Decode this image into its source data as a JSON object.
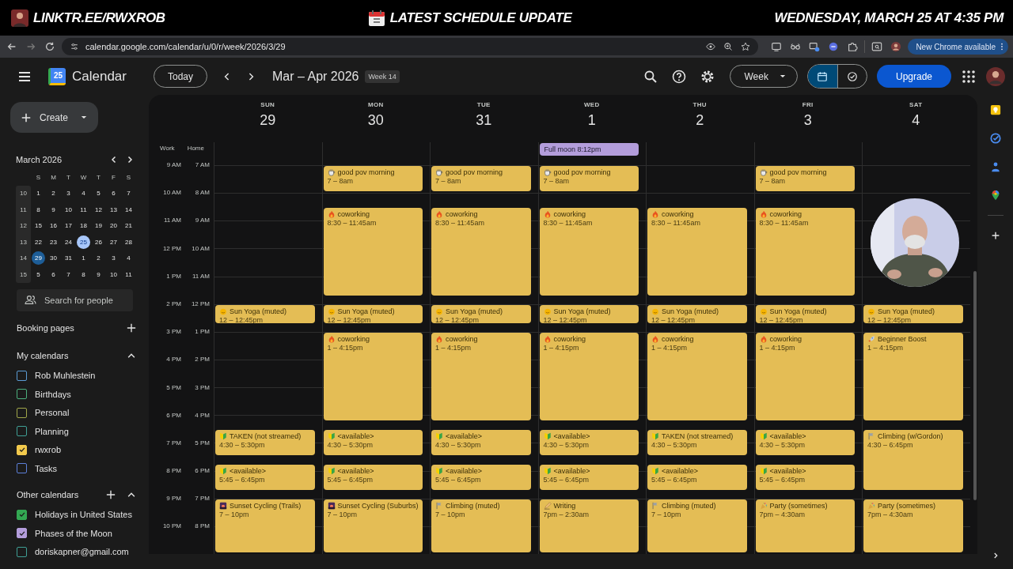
{
  "banner": {
    "left": "LINKTR.EE/RWXROB",
    "center": "LATEST SCHEDULE UPDATE",
    "right": "WEDNESDAY, MARCH 25 AT 4:35 PM"
  },
  "browser": {
    "url": "calendar.google.com/calendar/u/0/r/week/2026/3/29",
    "update_button": "New Chrome available"
  },
  "header": {
    "logo_day": "25",
    "app_name": "Calendar",
    "today_button": "Today",
    "range": "Mar – Apr 2026",
    "week_badge": "Week 14",
    "view_menu": "Week",
    "upgrade_button": "Upgrade",
    "view_toggle": [
      {
        "kind": "calendar",
        "selected": true
      },
      {
        "kind": "tasks",
        "selected": false
      }
    ]
  },
  "sidebar": {
    "create_button": "Create",
    "mini_calendar": {
      "title": "March 2026",
      "weekdays": [
        "S",
        "M",
        "T",
        "W",
        "T",
        "F",
        "S"
      ],
      "weeks": [
        {
          "week": "10",
          "days": [
            {
              "label": "1",
              "today": false,
              "selected": false
            },
            {
              "label": "2",
              "today": false,
              "selected": false
            },
            {
              "label": "3",
              "today": false,
              "selected": false
            },
            {
              "label": "4",
              "today": false,
              "selected": false
            },
            {
              "label": "5",
              "today": false,
              "selected": false
            },
            {
              "label": "6",
              "today": false,
              "selected": false
            },
            {
              "label": "7",
              "today": false,
              "selected": false
            }
          ]
        },
        {
          "week": "11",
          "days": [
            {
              "label": "8",
              "today": false,
              "selected": false
            },
            {
              "label": "9",
              "today": false,
              "selected": false
            },
            {
              "label": "10",
              "today": false,
              "selected": false
            },
            {
              "label": "11",
              "today": false,
              "selected": false
            },
            {
              "label": "12",
              "today": false,
              "selected": false
            },
            {
              "label": "13",
              "today": false,
              "selected": false
            },
            {
              "label": "14",
              "today": false,
              "selected": false
            }
          ]
        },
        {
          "week": "12",
          "days": [
            {
              "label": "15",
              "today": false,
              "selected": false
            },
            {
              "label": "16",
              "today": false,
              "selected": false
            },
            {
              "label": "17",
              "today": false,
              "selected": false
            },
            {
              "label": "18",
              "today": false,
              "selected": false
            },
            {
              "label": "19",
              "today": false,
              "selected": false
            },
            {
              "label": "20",
              "today": false,
              "selected": false
            },
            {
              "label": "21",
              "today": false,
              "selected": false
            }
          ]
        },
        {
          "week": "13",
          "days": [
            {
              "label": "22",
              "today": false,
              "selected": false
            },
            {
              "label": "23",
              "today": false,
              "selected": false
            },
            {
              "label": "24",
              "today": false,
              "selected": false
            },
            {
              "label": "25",
              "today": true,
              "selected": false
            },
            {
              "label": "26",
              "today": false,
              "selected": false
            },
            {
              "label": "27",
              "today": false,
              "selected": false
            },
            {
              "label": "28",
              "today": false,
              "selected": false
            }
          ]
        },
        {
          "week": "14",
          "days": [
            {
              "label": "29",
              "today": false,
              "selected": true
            },
            {
              "label": "30",
              "today": false,
              "selected": false
            },
            {
              "label": "31",
              "today": false,
              "selected": false
            },
            {
              "label": "1",
              "today": false,
              "selected": false
            },
            {
              "label": "2",
              "today": false,
              "selected": false
            },
            {
              "label": "3",
              "today": false,
              "selected": false
            },
            {
              "label": "4",
              "today": false,
              "selected": false
            }
          ]
        },
        {
          "week": "15",
          "days": [
            {
              "label": "5",
              "today": false,
              "selected": false
            },
            {
              "label": "6",
              "today": false,
              "selected": false
            },
            {
              "label": "7",
              "today": false,
              "selected": false
            },
            {
              "label": "8",
              "today": false,
              "selected": false
            },
            {
              "label": "9",
              "today": false,
              "selected": false
            },
            {
              "label": "10",
              "today": false,
              "selected": false
            },
            {
              "label": "11",
              "today": false,
              "selected": false
            }
          ]
        }
      ]
    },
    "people_search": {
      "placeholder": "Search for people"
    },
    "booking_pages": "Booking pages",
    "my_calendars": {
      "title": "My calendars",
      "expanded": true,
      "items": [
        {
          "name": "Rob Muhlestein",
          "color": "#5b9bd5",
          "checked": false
        },
        {
          "name": "Birthdays",
          "color": "#4caf7d",
          "checked": false
        },
        {
          "name": "Personal",
          "color": "#a0a64a",
          "checked": false
        },
        {
          "name": "Planning",
          "color": "#3f9f95",
          "checked": false
        },
        {
          "name": "rwxrob",
          "color": "#f2c94c",
          "checked": true
        },
        {
          "name": "Tasks",
          "color": "#5c7fd8",
          "checked": false
        }
      ]
    },
    "other_calendars": {
      "title": "Other calendars",
      "expanded": true,
      "items": [
        {
          "name": "Holidays in United States",
          "color": "#33a852",
          "checked": true
        },
        {
          "name": "Phases of the Moon",
          "color": "#b39ddb",
          "checked": true
        },
        {
          "name": "doriskapner@gmail.com",
          "color": "#3f9f95",
          "checked": false
        }
      ]
    }
  },
  "time_axis": {
    "zones": [
      "Work",
      "Home"
    ],
    "rows": [
      {
        "work": "9 AM",
        "home": "7 AM"
      },
      {
        "work": "10 AM",
        "home": "8 AM"
      },
      {
        "work": "11 AM",
        "home": "9 AM"
      },
      {
        "work": "12 PM",
        "home": "10 AM"
      },
      {
        "work": "1 PM",
        "home": "11 AM"
      },
      {
        "work": "2 PM",
        "home": "12 PM"
      },
      {
        "work": "3 PM",
        "home": "1 PM"
      },
      {
        "work": "4 PM",
        "home": "2 PM"
      },
      {
        "work": "5 PM",
        "home": "3 PM"
      },
      {
        "work": "6 PM",
        "home": "4 PM"
      },
      {
        "work": "7 PM",
        "home": "5 PM"
      },
      {
        "work": "8 PM",
        "home": "6 PM"
      },
      {
        "work": "9 PM",
        "home": "7 PM"
      },
      {
        "work": "10 PM",
        "home": "8 PM"
      }
    ]
  },
  "days": [
    {
      "weekday": "SUN",
      "date": "29",
      "events": [
        {
          "kind": "yoga",
          "title": "Sun Yoga (muted)",
          "time": "12 – 12:45pm"
        },
        {
          "kind": "beginner",
          "title": "TAKEN (not streamed)",
          "time": "4:30 – 5:30pm"
        },
        {
          "kind": "beginner",
          "title": "<available>",
          "time": "5:45 – 6:45pm"
        },
        {
          "kind": "sunset",
          "title": "Sunset Cycling (Trails)",
          "time": "7 – 10pm"
        }
      ]
    },
    {
      "weekday": "MON",
      "date": "30",
      "events": [
        {
          "kind": "coffee",
          "title": "good pov morning",
          "time": "7 – 8am"
        },
        {
          "kind": "fire",
          "title": "coworking",
          "time": "8:30 – 11:45am"
        },
        {
          "kind": "yoga",
          "title": "Sun Yoga (muted)",
          "time": "12 – 12:45pm"
        },
        {
          "kind": "fire",
          "title": "coworking",
          "time": "1 – 4:15pm"
        },
        {
          "kind": "beginner",
          "title": "<available>",
          "time": "4:30 – 5:30pm"
        },
        {
          "kind": "beginner",
          "title": "<available>",
          "time": "5:45 – 6:45pm"
        },
        {
          "kind": "sunset",
          "title": "Sunset Cycling (Suburbs)",
          "time": "7 – 10pm"
        }
      ]
    },
    {
      "weekday": "TUE",
      "date": "31",
      "events": [
        {
          "kind": "coffee",
          "title": "good pov morning",
          "time": "7 – 8am"
        },
        {
          "kind": "fire",
          "title": "coworking",
          "time": "8:30 – 11:45am"
        },
        {
          "kind": "yoga",
          "title": "Sun Yoga (muted)",
          "time": "12 – 12:45pm"
        },
        {
          "kind": "fire",
          "title": "coworking",
          "time": "1 – 4:15pm"
        },
        {
          "kind": "beginner",
          "title": "<available>",
          "time": "4:30 – 5:30pm"
        },
        {
          "kind": "beginner",
          "title": "<available>",
          "time": "5:45 – 6:45pm"
        },
        {
          "kind": "flag",
          "title": "Climbing (muted)",
          "time": "7 – 10pm"
        }
      ]
    },
    {
      "weekday": "WED",
      "date": "1",
      "all_day": [
        {
          "title": "Full moon 8:12pm"
        }
      ],
      "events": [
        {
          "kind": "coffee",
          "title": "good pov morning",
          "time": "7 – 8am"
        },
        {
          "kind": "fire",
          "title": "coworking",
          "time": "8:30 – 11:45am"
        },
        {
          "kind": "yoga",
          "title": "Sun Yoga (muted)",
          "time": "12 – 12:45pm"
        },
        {
          "kind": "fire",
          "title": "coworking",
          "time": "1 – 4:15pm"
        },
        {
          "kind": "beginner",
          "title": "<available>",
          "time": "4:30 – 5:30pm"
        },
        {
          "kind": "beginner",
          "title": "<available>",
          "time": "5:45 – 6:45pm"
        },
        {
          "kind": "pen",
          "title": "Writing",
          "time": "7pm – 2:30am"
        }
      ]
    },
    {
      "weekday": "THU",
      "date": "2",
      "events": [
        {
          "kind": "fire",
          "title": "coworking",
          "time": "8:30 – 11:45am"
        },
        {
          "kind": "yoga",
          "title": "Sun Yoga (muted)",
          "time": "12 – 12:45pm"
        },
        {
          "kind": "fire",
          "title": "coworking",
          "time": "1 – 4:15pm"
        },
        {
          "kind": "beginner",
          "title": "TAKEN (not streamed)",
          "time": "4:30 – 5:30pm"
        },
        {
          "kind": "beginner",
          "title": "<available>",
          "time": "5:45 – 6:45pm"
        },
        {
          "kind": "flag",
          "title": "Climbing (muted)",
          "time": "7 – 10pm"
        }
      ]
    },
    {
      "weekday": "FRI",
      "date": "3",
      "events": [
        {
          "kind": "coffee",
          "title": "good pov morning",
          "time": "7 – 8am"
        },
        {
          "kind": "fire",
          "title": "coworking",
          "time": "8:30 – 11:45am"
        },
        {
          "kind": "yoga",
          "title": "Sun Yoga (muted)",
          "time": "12 – 12:45pm"
        },
        {
          "kind": "fire",
          "title": "coworking",
          "time": "1 – 4:15pm"
        },
        {
          "kind": "beginner",
          "title": "<available>",
          "time": "4:30 – 5:30pm"
        },
        {
          "kind": "beginner",
          "title": "<available>",
          "time": "5:45 – 6:45pm"
        },
        {
          "kind": "party",
          "title": "Party (sometimes)",
          "time": "7pm – 4:30am"
        }
      ]
    },
    {
      "weekday": "SAT",
      "date": "4",
      "events": [
        {
          "kind": "yoga",
          "title": "Sun Yoga (muted)",
          "time": "12 – 12:45pm"
        },
        {
          "kind": "rocket",
          "title": "Beginner Boost",
          "time": "1 – 4:15pm"
        },
        {
          "kind": "flag",
          "title": "Climbing (w/Gordon)",
          "time": "4:30 – 6:45pm"
        },
        {
          "kind": "party",
          "title": "Party (sometimes)",
          "time": "7pm – 4:30am"
        }
      ]
    }
  ]
}
